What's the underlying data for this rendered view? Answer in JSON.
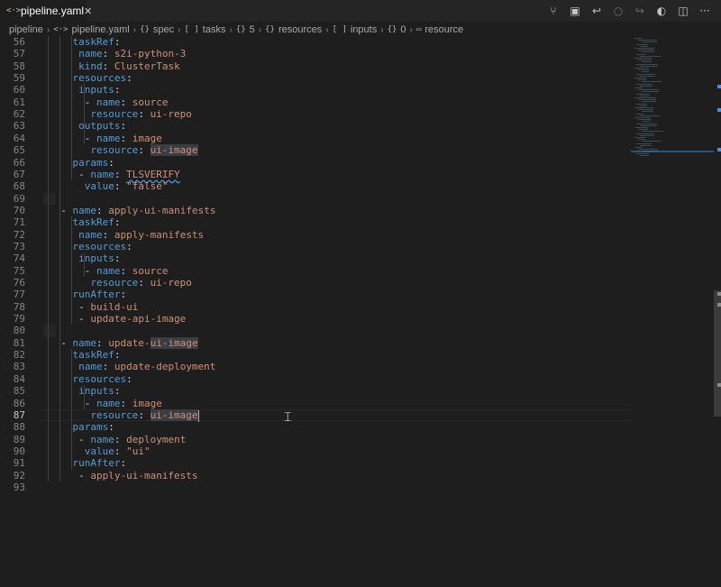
{
  "tab": {
    "icon": "<·>",
    "label": "pipeline.yaml",
    "close": "✕"
  },
  "toolbar_actions": [
    {
      "name": "source-control-icon",
      "glyph": "⑂"
    },
    {
      "name": "open-preview-icon",
      "glyph": "▣"
    },
    {
      "name": "go-back-icon",
      "glyph": "↩"
    },
    {
      "name": "go-center-icon",
      "glyph": "○"
    },
    {
      "name": "go-forward-icon",
      "glyph": "↪"
    },
    {
      "name": "toggle-icon",
      "glyph": "◐"
    },
    {
      "name": "split-editor-icon",
      "glyph": "◫"
    },
    {
      "name": "more-actions-icon",
      "glyph": "···"
    }
  ],
  "breadcrumbs": [
    {
      "icon": "",
      "label": "pipeline"
    },
    {
      "icon": "<·>",
      "label": "pipeline.yaml"
    },
    {
      "icon": "{}",
      "label": "spec"
    },
    {
      "icon": "[ ]",
      "label": "tasks"
    },
    {
      "icon": "{}",
      "label": "5"
    },
    {
      "icon": "{}",
      "label": "resources"
    },
    {
      "icon": "[ ]",
      "label": "inputs"
    },
    {
      "icon": "{}",
      "label": "0"
    },
    {
      "icon": "▭",
      "label": "resource"
    }
  ],
  "active_line": 87,
  "lines": [
    {
      "n": 56,
      "indent": 4,
      "parts": [
        [
          "k",
          "taskRef"
        ],
        [
          "p",
          ":"
        ]
      ]
    },
    {
      "n": 57,
      "indent": 5,
      "parts": [
        [
          "k",
          "name"
        ],
        [
          "p",
          ": "
        ],
        [
          "s",
          "s2i-python-3"
        ]
      ]
    },
    {
      "n": 58,
      "indent": 5,
      "parts": [
        [
          "k",
          "kind"
        ],
        [
          "p",
          ": "
        ],
        [
          "s",
          "ClusterTask"
        ]
      ]
    },
    {
      "n": 59,
      "indent": 4,
      "parts": [
        [
          "k",
          "resources"
        ],
        [
          "p",
          ":"
        ]
      ]
    },
    {
      "n": 60,
      "indent": 5,
      "parts": [
        [
          "k",
          "inputs"
        ],
        [
          "p",
          ":"
        ]
      ]
    },
    {
      "n": 61,
      "indent": 6,
      "parts": [
        [
          "p",
          "- "
        ],
        [
          "k",
          "name"
        ],
        [
          "p",
          ": "
        ],
        [
          "s",
          "source"
        ]
      ]
    },
    {
      "n": 62,
      "indent": 7,
      "parts": [
        [
          "k",
          "resource"
        ],
        [
          "p",
          ": "
        ],
        [
          "s",
          "ui-repo"
        ]
      ]
    },
    {
      "n": 63,
      "indent": 5,
      "parts": [
        [
          "k",
          "outputs"
        ],
        [
          "p",
          ":"
        ]
      ]
    },
    {
      "n": 64,
      "indent": 6,
      "parts": [
        [
          "p",
          "- "
        ],
        [
          "k",
          "name"
        ],
        [
          "p",
          ": "
        ],
        [
          "s",
          "image"
        ]
      ]
    },
    {
      "n": 65,
      "indent": 7,
      "parts": [
        [
          "k",
          "resource"
        ],
        [
          "p",
          ": "
        ],
        [
          "s hl",
          "ui-image"
        ]
      ]
    },
    {
      "n": 66,
      "indent": 4,
      "parts": [
        [
          "k",
          "params"
        ],
        [
          "p",
          ":"
        ]
      ]
    },
    {
      "n": 67,
      "indent": 5,
      "parts": [
        [
          "p",
          "- "
        ],
        [
          "k",
          "name"
        ],
        [
          "p",
          ": "
        ],
        [
          "s warn",
          "TLSVERIFY"
        ]
      ]
    },
    {
      "n": 68,
      "indent": 6,
      "parts": [
        [
          "k",
          "value"
        ],
        [
          "p",
          ": "
        ],
        [
          "s",
          "\"false\""
        ]
      ]
    },
    {
      "n": 69,
      "indent": 0,
      "parts": []
    },
    {
      "n": 70,
      "indent": 2,
      "parts": [
        [
          "p",
          "- "
        ],
        [
          "k",
          "name"
        ],
        [
          "p",
          ": "
        ],
        [
          "s",
          "apply-ui-manifests"
        ]
      ]
    },
    {
      "n": 71,
      "indent": 4,
      "parts": [
        [
          "k",
          "taskRef"
        ],
        [
          "p",
          ":"
        ]
      ]
    },
    {
      "n": 72,
      "indent": 5,
      "parts": [
        [
          "k",
          "name"
        ],
        [
          "p",
          ": "
        ],
        [
          "s",
          "apply-manifests"
        ]
      ]
    },
    {
      "n": 73,
      "indent": 4,
      "parts": [
        [
          "k",
          "resources"
        ],
        [
          "p",
          ":"
        ]
      ]
    },
    {
      "n": 74,
      "indent": 5,
      "parts": [
        [
          "k",
          "inputs"
        ],
        [
          "p",
          ":"
        ]
      ]
    },
    {
      "n": 75,
      "indent": 6,
      "parts": [
        [
          "p",
          "- "
        ],
        [
          "k",
          "name"
        ],
        [
          "p",
          ": "
        ],
        [
          "s",
          "source"
        ]
      ]
    },
    {
      "n": 76,
      "indent": 7,
      "parts": [
        [
          "k",
          "resource"
        ],
        [
          "p",
          ": "
        ],
        [
          "s",
          "ui-repo"
        ]
      ]
    },
    {
      "n": 77,
      "indent": 4,
      "parts": [
        [
          "k",
          "runAfter"
        ],
        [
          "p",
          ":"
        ]
      ]
    },
    {
      "n": 78,
      "indent": 5,
      "parts": [
        [
          "p",
          "- "
        ],
        [
          "s",
          "build-ui"
        ]
      ]
    },
    {
      "n": 79,
      "indent": 5,
      "parts": [
        [
          "p",
          "- "
        ],
        [
          "s",
          "update-api-image"
        ]
      ]
    },
    {
      "n": 80,
      "indent": 0,
      "parts": []
    },
    {
      "n": 81,
      "indent": 2,
      "parts": [
        [
          "p",
          "- "
        ],
        [
          "k",
          "name"
        ],
        [
          "p",
          ": "
        ],
        [
          "s",
          "update-"
        ],
        [
          "s hl",
          "ui-image"
        ]
      ]
    },
    {
      "n": 82,
      "indent": 4,
      "parts": [
        [
          "k",
          "taskRef"
        ],
        [
          "p",
          ":"
        ]
      ]
    },
    {
      "n": 83,
      "indent": 5,
      "parts": [
        [
          "k",
          "name"
        ],
        [
          "p",
          ": "
        ],
        [
          "s",
          "update-deployment"
        ]
      ]
    },
    {
      "n": 84,
      "indent": 4,
      "parts": [
        [
          "k",
          "resources"
        ],
        [
          "p",
          ":"
        ]
      ]
    },
    {
      "n": 85,
      "indent": 5,
      "parts": [
        [
          "k",
          "inputs"
        ],
        [
          "p",
          ":"
        ]
      ]
    },
    {
      "n": 86,
      "indent": 6,
      "parts": [
        [
          "p",
          "- "
        ],
        [
          "k",
          "name"
        ],
        [
          "p",
          ": "
        ],
        [
          "s",
          "image"
        ]
      ]
    },
    {
      "n": 87,
      "indent": 7,
      "parts": [
        [
          "k",
          "resource"
        ],
        [
          "p",
          ": "
        ],
        [
          "s hl",
          "ui-image"
        ]
      ]
    },
    {
      "n": 88,
      "indent": 4,
      "parts": [
        [
          "k",
          "params"
        ],
        [
          "p",
          ":"
        ]
      ]
    },
    {
      "n": 89,
      "indent": 5,
      "parts": [
        [
          "p",
          "- "
        ],
        [
          "k",
          "name"
        ],
        [
          "p",
          ": "
        ],
        [
          "s",
          "deployment"
        ]
      ]
    },
    {
      "n": 90,
      "indent": 6,
      "parts": [
        [
          "k",
          "value"
        ],
        [
          "p",
          ": "
        ],
        [
          "s",
          "\"ui\""
        ]
      ]
    },
    {
      "n": 91,
      "indent": 4,
      "parts": [
        [
          "k",
          "runAfter"
        ],
        [
          "p",
          ":"
        ]
      ]
    },
    {
      "n": 92,
      "indent": 5,
      "parts": [
        [
          "p",
          "- "
        ],
        [
          "s",
          "apply-ui-manifests"
        ]
      ]
    },
    {
      "n": 93,
      "indent": 0,
      "parts": []
    }
  ],
  "colors": {
    "background": "#1e1e1e",
    "key": "#569cd6",
    "string": "#ce9178",
    "accent": "#3794ff"
  }
}
